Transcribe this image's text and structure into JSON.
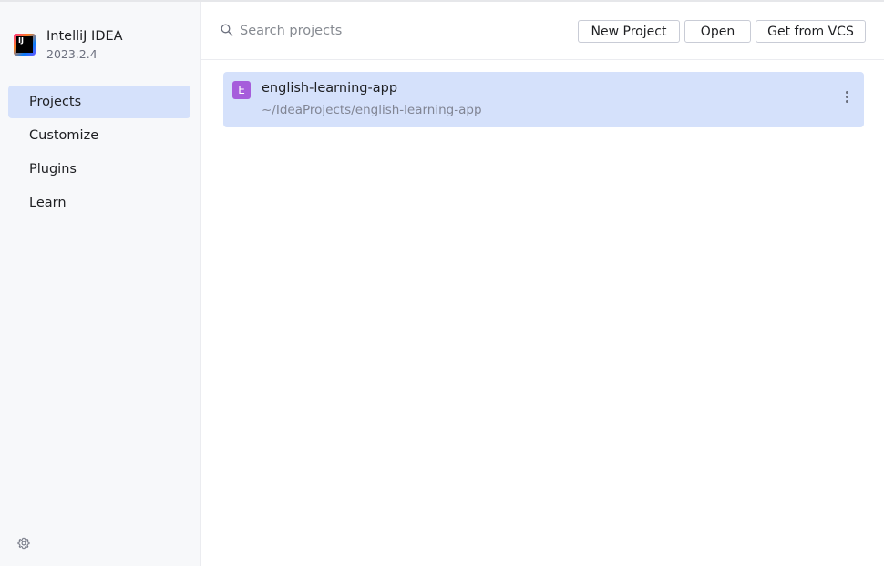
{
  "app": {
    "name": "IntelliJ IDEA",
    "version": "2023.2.4",
    "logo_text": "IJ"
  },
  "sidebar": {
    "items": [
      {
        "label": "Projects",
        "active": true
      },
      {
        "label": "Customize",
        "active": false
      },
      {
        "label": "Plugins",
        "active": false
      },
      {
        "label": "Learn",
        "active": false
      }
    ],
    "settings_icon": "gear-icon"
  },
  "search": {
    "placeholder": "Search projects",
    "value": ""
  },
  "toolbar": {
    "new_project_label": "New Project",
    "open_label": "Open",
    "vcs_label": "Get from VCS"
  },
  "projects": [
    {
      "badge": "E",
      "name": "english-learning-app",
      "path": "~/IdeaProjects/english-learning-app",
      "badge_color": "#a65ddb",
      "selected": true
    }
  ],
  "colors": {
    "accent_selected": "#d5e1fb",
    "sidebar_bg": "#f7f8fa"
  }
}
